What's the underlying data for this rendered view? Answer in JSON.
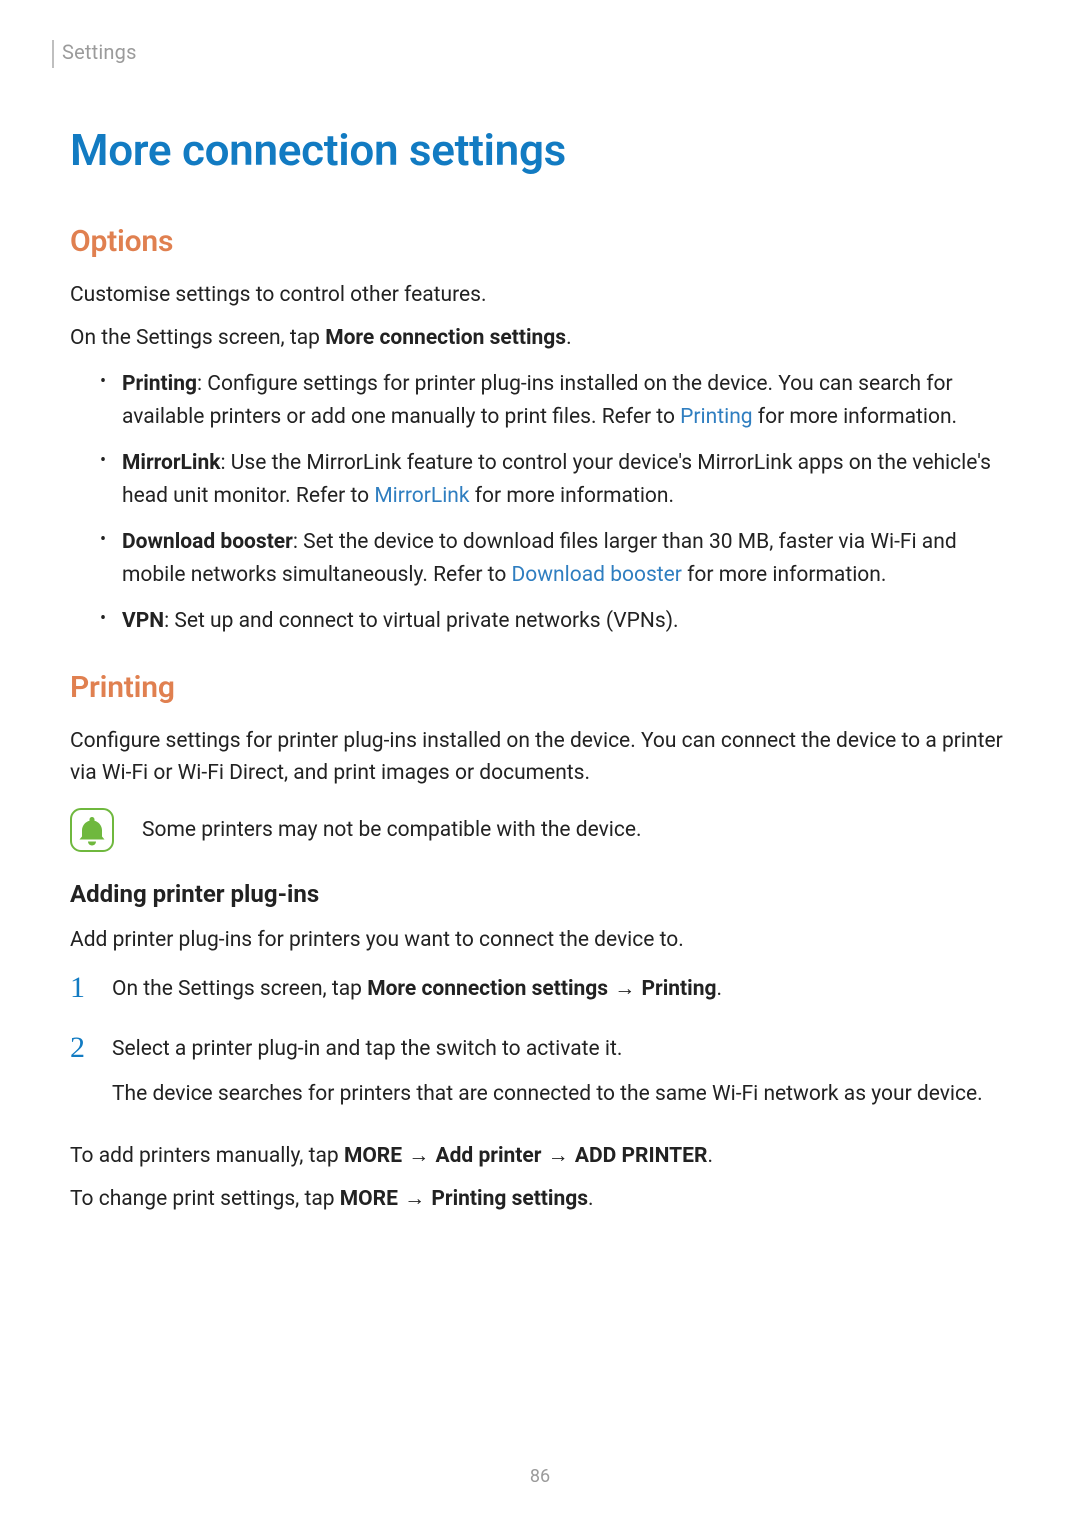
{
  "header": {
    "section": "Settings"
  },
  "title": "More connection settings",
  "options": {
    "heading": "Options",
    "intro": "Customise settings to control other features.",
    "instruction_pre": "On the Settings screen, tap ",
    "instruction_bold": "More connection settings",
    "instruction_post": ".",
    "items": [
      {
        "name": "Printing",
        "desc_before": ": Configure settings for printer plug-ins installed on the device. You can search for available printers or add one manually to print files. Refer to ",
        "link": "Printing",
        "desc_after": " for more information."
      },
      {
        "name": "MirrorLink",
        "desc_before": ": Use the MirrorLink feature to control your device's MirrorLink apps on the vehicle's head unit monitor. Refer to ",
        "link": "MirrorLink",
        "desc_after": " for more information."
      },
      {
        "name": "Download booster",
        "desc_before": ": Set the device to download files larger than 30 MB, faster via Wi-Fi and mobile networks simultaneously. Refer to ",
        "link": "Download booster",
        "desc_after": " for more information."
      },
      {
        "name": "VPN",
        "desc_before": ": Set up and connect to virtual private networks (VPNs).",
        "link": "",
        "desc_after": ""
      }
    ]
  },
  "printing": {
    "heading": "Printing",
    "intro": "Configure settings for printer plug-ins installed on the device. You can connect the device to a printer via Wi-Fi or Wi-Fi Direct, and print images or documents.",
    "note": "Some printers may not be compatible with the device.",
    "sub_heading": "Adding printer plug-ins",
    "sub_intro": "Add printer plug-ins for printers you want to connect the device to.",
    "steps": [
      {
        "num": "1",
        "pre": "On the Settings screen, tap ",
        "bold1": "More connection settings",
        "arrow1": " → ",
        "bold2": "Printing",
        "post": "."
      },
      {
        "num": "2",
        "line1": "Select a printer plug-in and tap the switch to activate it.",
        "line2": "The device searches for printers that are connected to the same Wi-Fi network as your device."
      }
    ],
    "manual_pre": "To add printers manually, tap ",
    "manual_b1": "MORE",
    "manual_a1": " → ",
    "manual_b2": "Add printer",
    "manual_a2": " → ",
    "manual_b3": "ADD PRINTER",
    "manual_post": ".",
    "change_pre": "To change print settings, tap ",
    "change_b1": "MORE",
    "change_a1": " → ",
    "change_b2": "Printing settings",
    "change_post": "."
  },
  "page_number": "86"
}
